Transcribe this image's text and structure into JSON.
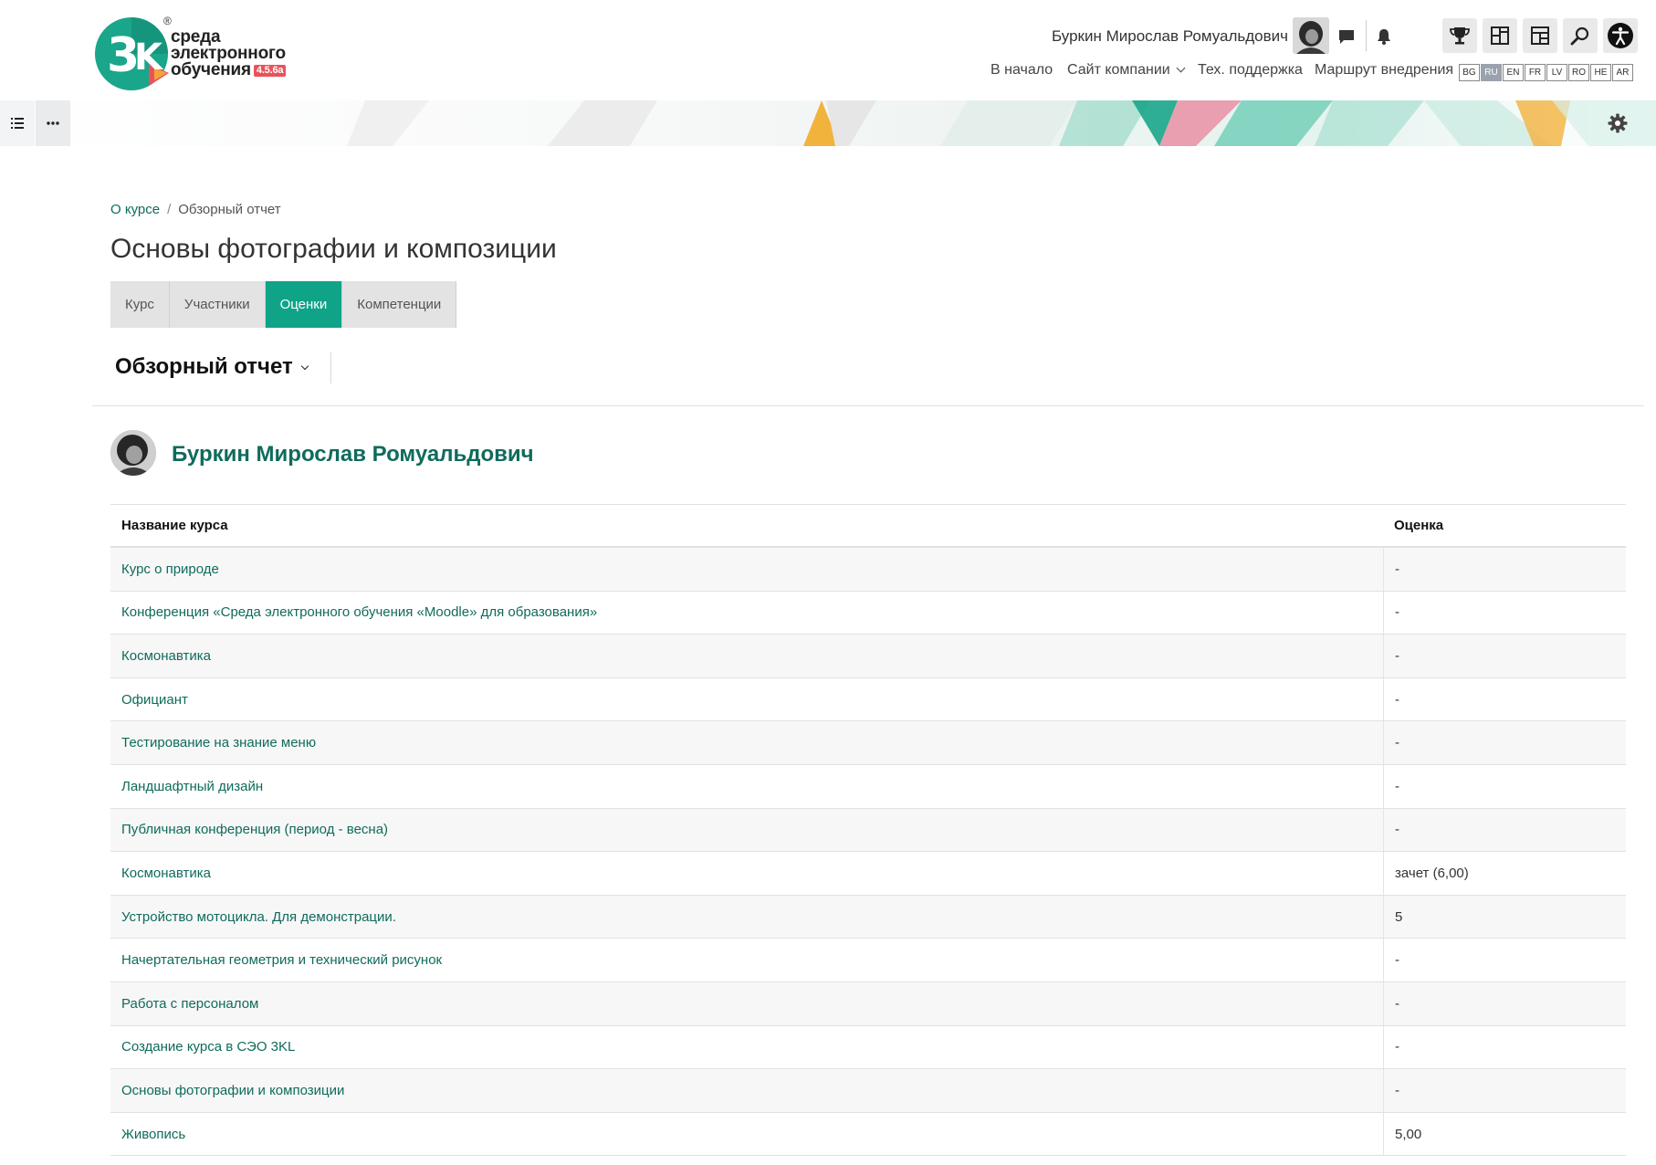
{
  "header": {
    "logo": {
      "line1": "среда",
      "line2": "электронного",
      "line3": "обучения",
      "version": "4.5.6a",
      "registered": "®",
      "mark": "ЗК"
    },
    "user_name": "Буркин Мирослав Ромуальдович",
    "icons": [
      "chat-icon",
      "bell-icon",
      "trophy-icon",
      "dashboard-icon",
      "layout-icon",
      "search-icon",
      "accessibility-icon"
    ],
    "nav": [
      {
        "label": "В начало"
      },
      {
        "label": "Сайт компании",
        "has_dropdown": true
      },
      {
        "label": "Тех. поддержка"
      },
      {
        "label": "Маршрут внедрения"
      }
    ],
    "languages": [
      "BG",
      "RU",
      "EN",
      "FR",
      "LV",
      "RO",
      "HE",
      "AR"
    ],
    "active_language": "RU"
  },
  "breadcrumb": {
    "first": "О курсе",
    "separator": "/",
    "current": "Обзорный отчет"
  },
  "page_title": "Основы фотографии и композиции",
  "tabs": [
    {
      "label": "Курс"
    },
    {
      "label": "Участники"
    },
    {
      "label": "Оценки",
      "active": true
    },
    {
      "label": "Компетенции"
    }
  ],
  "report_selector": "Обзорный отчет",
  "profile": {
    "name": "Буркин Мирослав Ромуальдович"
  },
  "table": {
    "headers": {
      "course": "Название курса",
      "grade": "Оценка"
    },
    "rows": [
      {
        "course": "Курс о природе",
        "grade": "-"
      },
      {
        "course": "Конференция «Среда электронного обучения «Moodle» для образования»",
        "grade": "-"
      },
      {
        "course": "Космонавтика",
        "grade": "-"
      },
      {
        "course": "Официант",
        "grade": "-"
      },
      {
        "course": "Тестирование на знание меню",
        "grade": "-"
      },
      {
        "course": "Ландшафтный дизайн",
        "grade": "-"
      },
      {
        "course": "Публичная конференция (период - весна)",
        "grade": "-"
      },
      {
        "course": "Космонавтика",
        "grade": "зачет (6,00)"
      },
      {
        "course": "Устройство мотоцикла. Для демонстрации.",
        "grade": "5"
      },
      {
        "course": "Начертательная геометрия и технический рисунок",
        "grade": "-"
      },
      {
        "course": "Работа с персоналом",
        "grade": "-"
      },
      {
        "course": "Создание курса в СЭО 3KL",
        "grade": "-"
      },
      {
        "course": "Основы фотографии и композиции",
        "grade": "-"
      },
      {
        "course": "Живопись",
        "grade": "5,00"
      }
    ]
  },
  "colors": {
    "accent": "#0fa388",
    "link": "#0f6b5c",
    "tab_bg": "#e3e3e3"
  }
}
